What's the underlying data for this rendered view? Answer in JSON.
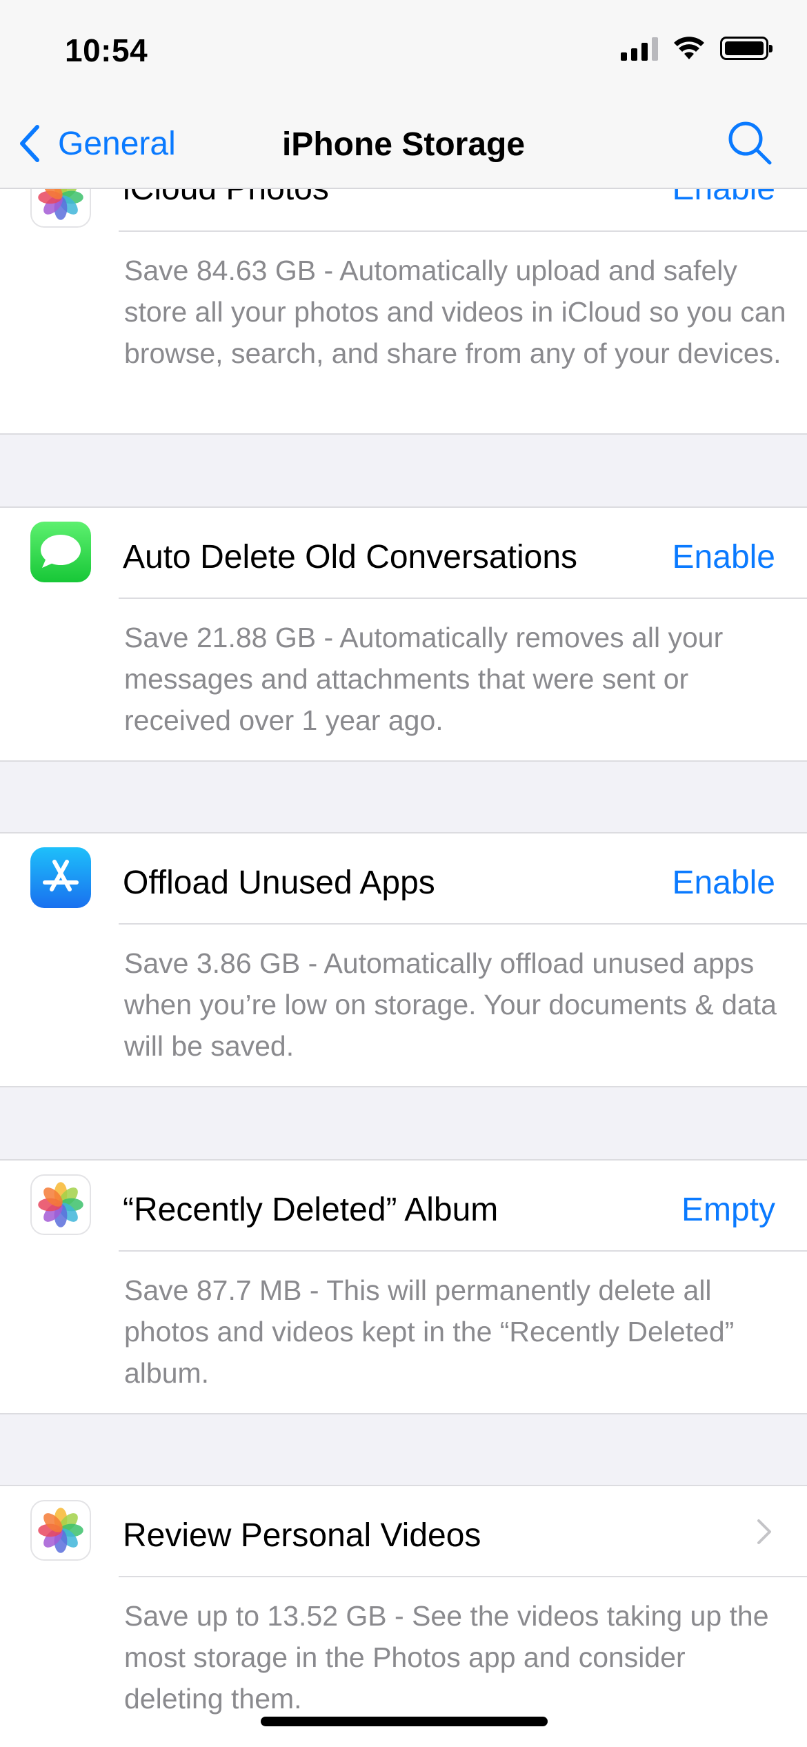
{
  "status_bar": {
    "time": "10:54"
  },
  "nav": {
    "back_label": "General",
    "title": "iPhone Storage"
  },
  "recommendations": [
    {
      "title": "iCloud Photos",
      "action": "Enable",
      "description": "Save 84.63 GB - Automatically upload and safely store all your photos and videos in iCloud so you can browse, search, and share from any of your devices.",
      "icon": "photos-icon"
    },
    {
      "title": "Auto Delete Old Conversations",
      "action": "Enable",
      "description": "Save 21.88 GB - Automatically removes all your messages and attachments that were sent or received over 1 year ago.",
      "icon": "messages-icon"
    },
    {
      "title": "Offload Unused Apps",
      "action": "Enable",
      "description": "Save 3.86 GB - Automatically offload unused apps when you’re low on storage. Your documents & data will be saved.",
      "icon": "app-store-icon"
    },
    {
      "title": "“Recently Deleted” Album",
      "action": "Empty",
      "description": "Save 87.7 MB - This will permanently delete all photos and videos kept in the “Recently Deleted” album.",
      "icon": "photos-icon"
    },
    {
      "title": "Review Personal Videos",
      "action": "",
      "description": "Save up to 13.52 GB - See the videos taking up the most storage in the Photos app and consider deleting them.",
      "icon": "photos-icon"
    }
  ],
  "colors": {
    "accent": "#0a7aff",
    "background": "#f2f2f7",
    "secondary_text": "#8a8a8e"
  }
}
